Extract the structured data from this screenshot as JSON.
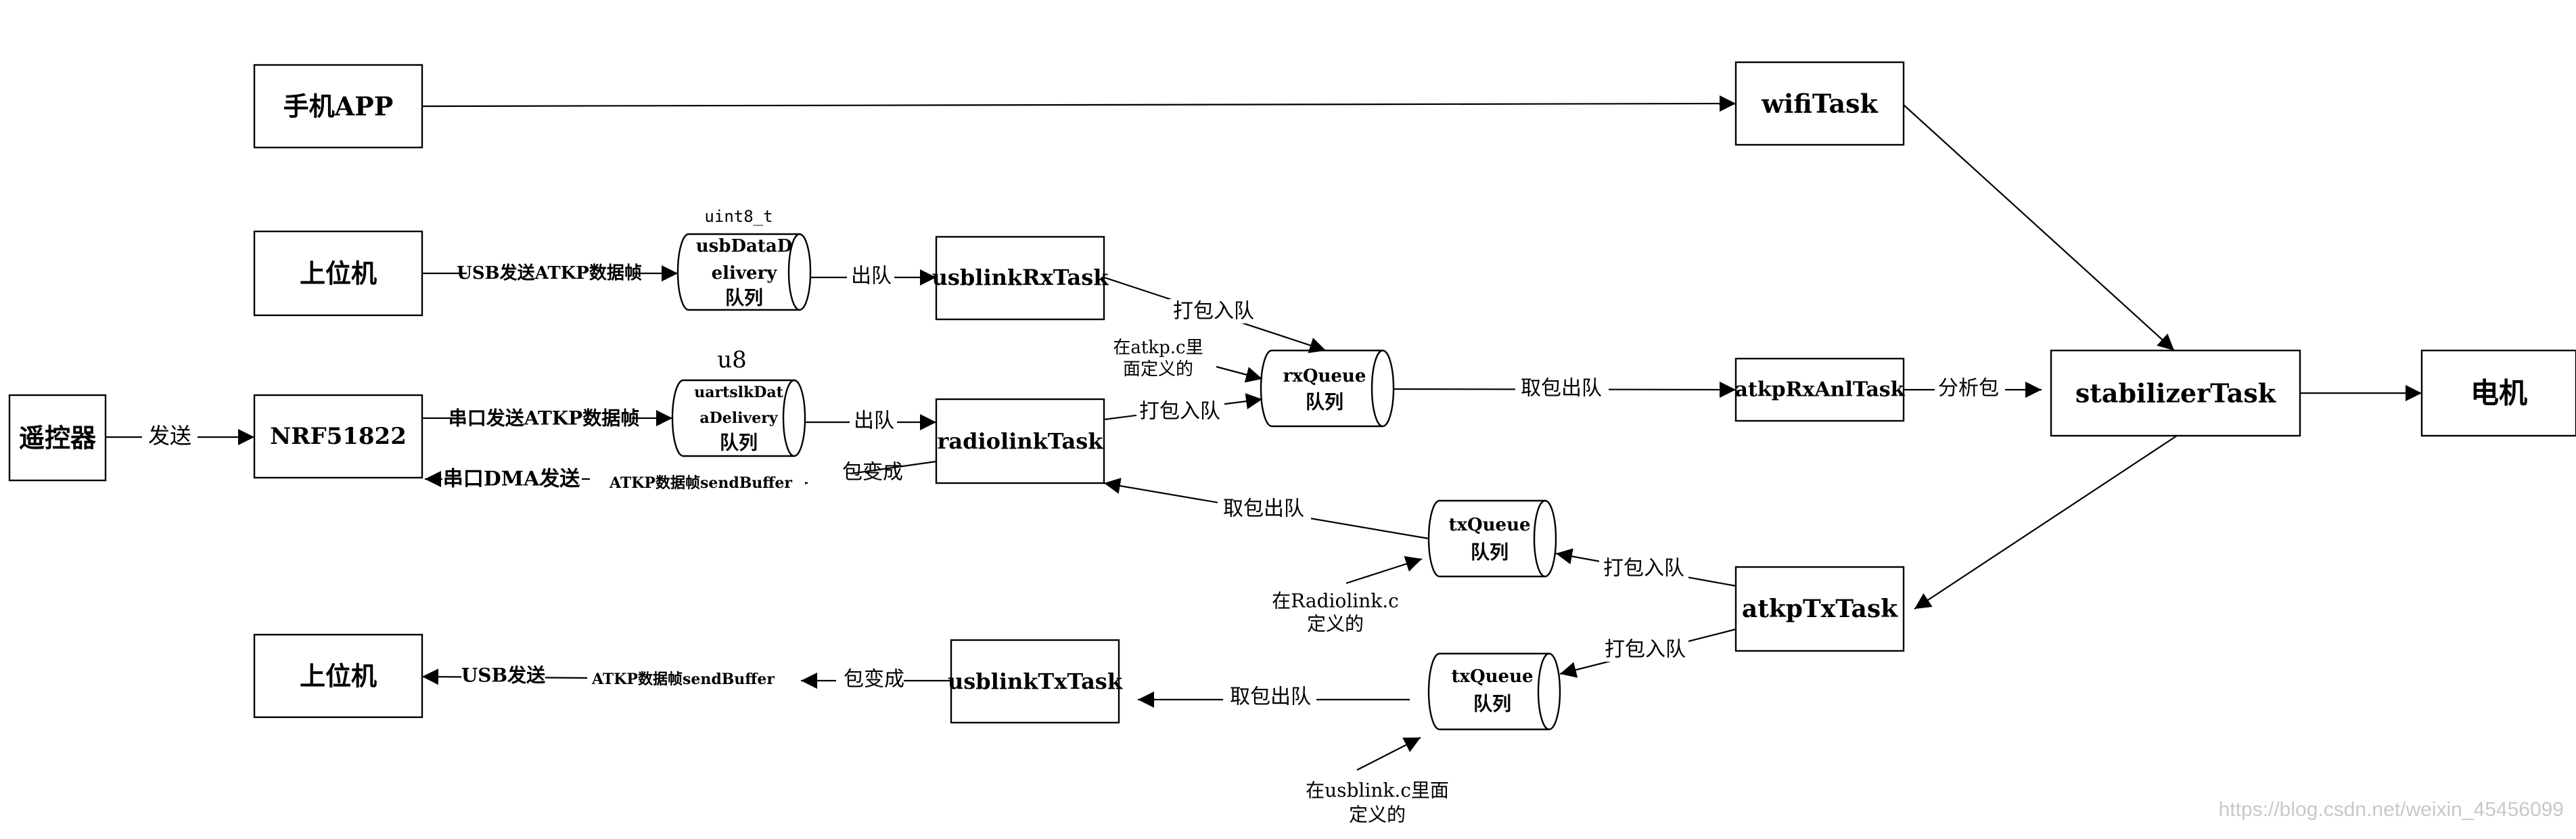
{
  "boxes": {
    "phone_app": "手机APP",
    "wifi_task": "wifiTask",
    "host_pc_top": "上位机",
    "usblink_rx_task": "usblinkRxTask",
    "remote": "遥控器",
    "nrf": "NRF51822",
    "radiolink_task": "radiolinkTask",
    "atkp_rx_anl_task": "atkpRxAnlTask",
    "stabilizer_task": "stabilizerTask",
    "motor": "电机",
    "atkp_tx_task": "atkpTxTask",
    "host_pc_bottom": "上位机",
    "usblink_tx_task": "usblinkTxTask"
  },
  "queues": {
    "usb_delivery": {
      "line1": "usbDataD",
      "line2": "elivery",
      "line3": "队列",
      "type_label": "uint8_t"
    },
    "uart_delivery": {
      "line1": "uartslkDat",
      "line2": "aDelivery",
      "line3": "队列",
      "type_label": "u8"
    },
    "rx_queue": {
      "line1": "rxQueue",
      "line2": "队列"
    },
    "tx_queue_radio": {
      "line1": "txQueue",
      "line2": "队列"
    },
    "tx_queue_usb": {
      "line1": "txQueue",
      "line2": "队列"
    }
  },
  "labels": {
    "usb_send_frame": "USB发送ATKP数据帧",
    "dequeue_1": "出队",
    "pack_enqueue_1": "打包入队",
    "atkp_note_line1": "在atkp.c里",
    "atkp_note_line2": "面定义的",
    "send": "发送",
    "uart_send_frame": "串口发送ATKP数据帧",
    "dequeue_2": "出队",
    "pack_enqueue_2": "打包入队",
    "take_dequeue_rx": "取包出队",
    "analyze_pkt": "分析包",
    "pkt_becomes_radio": "包变成",
    "uart_dma_send": "串口DMA发送",
    "atkp_send_buffer_radio": "ATKP数据帧sendBuffer",
    "take_dequeue_radio": "取包出队",
    "pack_enqueue_txradio": "打包入队",
    "radiolink_note_line1": "在Radiolink.c",
    "radiolink_note_line2": "定义的",
    "pack_enqueue_txusb": "打包入队",
    "usb_send": "USB发送",
    "atkp_send_buffer_usb": "ATKP数据帧sendBuffer",
    "pkt_becomes_usb": "包变成",
    "take_dequeue_usb": "取包出队",
    "usblink_note_line1": "在usblink.c里面",
    "usblink_note_line2": "定义的"
  },
  "watermark": "https://blog.csdn.net/weixin_45456099"
}
